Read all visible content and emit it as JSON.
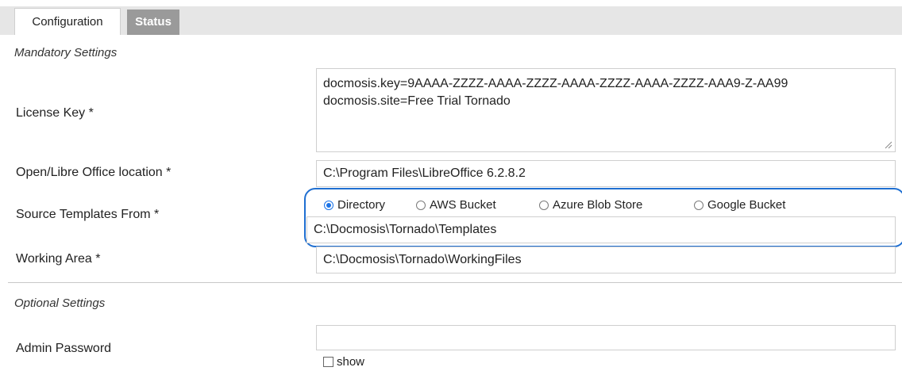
{
  "tabs": [
    {
      "label": "Configuration",
      "active": true
    },
    {
      "label": "Status",
      "active": false
    }
  ],
  "mandatory": {
    "heading": "Mandatory Settings",
    "license_key": {
      "label": "License Key *",
      "lines": [
        "docmosis.key=9AAAA-ZZZZ-AAAA-ZZZZ-AAAA-ZZZZ-AAAA-ZZZZ-AAA9-Z-AA99",
        "docmosis.site=Free Trial Tornado"
      ]
    },
    "office_location": {
      "label": "Open/Libre Office location *",
      "value": "C:\\Program Files\\LibreOffice 6.2.8.2"
    },
    "source_templates": {
      "label": "Source Templates From *",
      "options": [
        {
          "label": "Directory",
          "selected": true
        },
        {
          "label": "AWS Bucket",
          "selected": false
        },
        {
          "label": "Azure Blob Store",
          "selected": false
        },
        {
          "label": "Google Bucket",
          "selected": false
        }
      ],
      "value": "C:\\Docmosis\\Tornado\\Templates"
    },
    "working_area": {
      "label": "Working Area *",
      "value": "C:\\Docmosis\\Tornado\\WorkingFiles"
    }
  },
  "optional": {
    "heading": "Optional Settings",
    "admin_password": {
      "label": "Admin Password",
      "value": "",
      "show_label": "show"
    }
  },
  "colors": {
    "highlight": "#1f6fd1",
    "radio_selected": "#1a73e8",
    "status_tab_bg": "#9a9a9a"
  }
}
